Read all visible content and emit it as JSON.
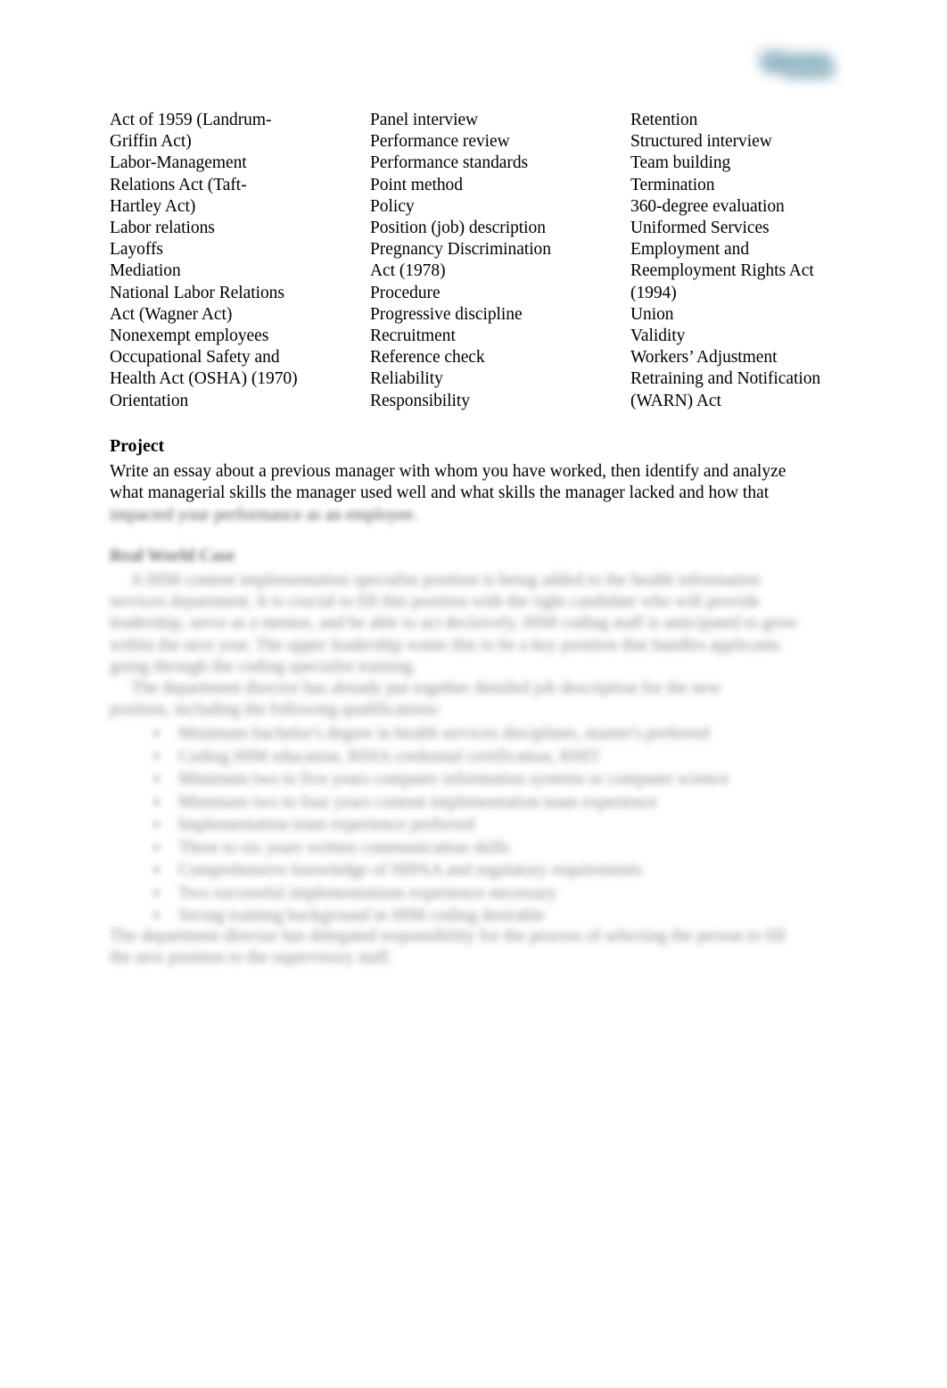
{
  "page": {
    "background_color": "#ffffff",
    "text_color": "#000000"
  },
  "logo": {
    "name": "publisher-logo-watermark",
    "accent_color": "#8db2c0",
    "description": "blurred teal-gray logo mark"
  },
  "glossary": {
    "columns": [
      {
        "name": "glossary-column-1",
        "lines": [
          "Act of 1959 (Landrum-",
          "Griffin Act)",
          "Labor-Management",
          "Relations Act (Taft-",
          "Hartley Act)",
          "Labor relations",
          "Layoffs",
          "Mediation",
          "National Labor Relations",
          "Act (Wagner Act)",
          "Nonexempt employees",
          "Occupational Safety and",
          "Health Act (OSHA) (1970)",
          "Orientation"
        ]
      },
      {
        "name": "glossary-column-2",
        "lines": [
          "Panel interview",
          "Performance review",
          "Performance standards",
          "Point method",
          "Policy",
          "Position (job) description",
          "Pregnancy Discrimination",
          "Act (1978)",
          "Procedure",
          "Progressive discipline",
          "Recruitment",
          "Reference check",
          "Reliability",
          "Responsibility"
        ]
      },
      {
        "name": "glossary-column-3",
        "lines": [
          "Retention",
          "Structured interview",
          "Team building",
          "Termination",
          "360-degree evaluation",
          "Uniformed Services",
          "Employment and",
          "Reemployment Rights Act",
          "(1994)",
          "Union",
          "Validity",
          "Workers’ Adjustment",
          "Retraining and Notification",
          "(WARN) Act"
        ]
      }
    ]
  },
  "project": {
    "heading": "Project",
    "lines": [
      "Write an essay about a previous manager with whom you have worked, then identify and analyze",
      "what managerial skills the manager used well and what skills the manager lacked and how that"
    ],
    "redacted_line": "impacted your performance as an employee."
  },
  "case_section": {
    "heading": "Real World Case",
    "paragraph_1_lines": [
      "     A HIM content implementation specialist position is being added to the health information",
      "services department. It is crucial to fill this position with the right candidate who will provide",
      "leadership, serve as a mentor, and be able to act decisively. HIM coding staff is anticipated to grow",
      "within the next year. The upper leadership wants this to be a key position that handles applicants",
      "going through the coding specialist training."
    ],
    "paragraph_2_lines": [
      "     The department director has already put together detailed job description for the new",
      "position, including the following qualifications:"
    ],
    "bullets": [
      "Minimum bachelor's degree in health services disciplines, master's preferred",
      "Coding HIM education, RHIA credential certification, RHIT",
      "Minimum two to five years computer information systems or computer science",
      "Minimum two to four years content implementation team experience",
      "Implementation team experience preferred",
      "Three to six years written communication skills",
      "Comprehensive knowledge of HIPAA and regulatory requirements",
      "Two successful implementations experience necessary",
      "Strong training background in HIM coding desirable"
    ],
    "closing_lines": [
      "The department director has delegated responsibility for the process of selecting the person to fill",
      "the new position to the supervisory staff."
    ],
    "bullet_glyph": "▪"
  }
}
